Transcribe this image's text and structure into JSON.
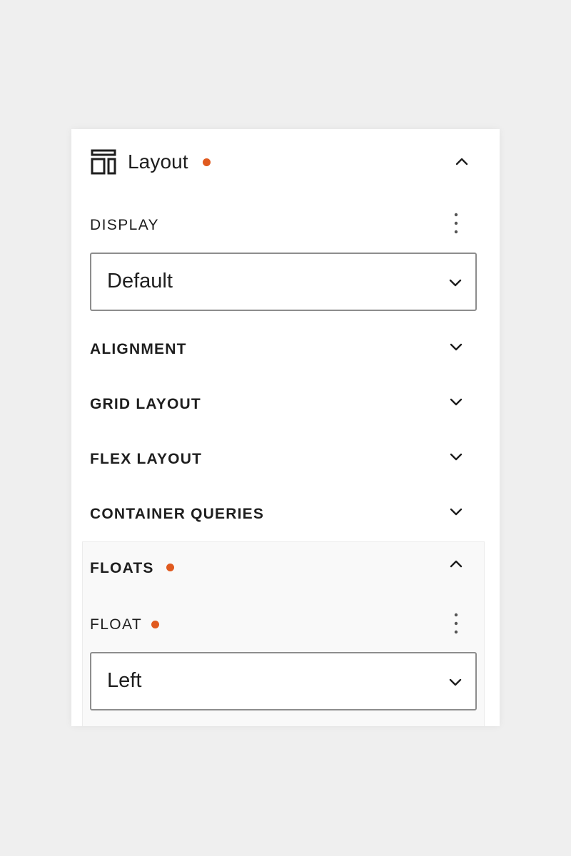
{
  "panel": {
    "title": "Layout",
    "accent_color": "#e05a1f",
    "icon": "layout-icon"
  },
  "display": {
    "label": "DISPLAY",
    "value": "Default"
  },
  "sections": [
    {
      "label": "ALIGNMENT",
      "expanded": false
    },
    {
      "label": "GRID LAYOUT",
      "expanded": false
    },
    {
      "label": "FLEX LAYOUT",
      "expanded": false
    },
    {
      "label": "CONTAINER QUERIES",
      "expanded": false
    }
  ],
  "floats": {
    "label": "FLOATS",
    "expanded": true,
    "float_label": "FLOAT",
    "float_value": "Left"
  }
}
